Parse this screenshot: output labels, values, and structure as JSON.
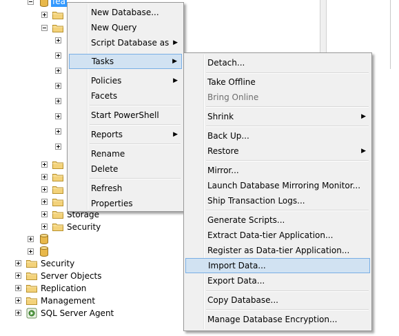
{
  "tree": {
    "selected_db_label": "fea",
    "storage_label": "Storage",
    "security_inner_label": "Security",
    "security_label": "Security",
    "server_objects_label": "Server Objects",
    "replication_label": "Replication",
    "management_label": "Management",
    "agent_label": "SQL Server Agent"
  },
  "context_menu": {
    "new_database": "New Database...",
    "new_query": "New Query",
    "script_database_as": "Script Database as",
    "tasks": "Tasks",
    "policies": "Policies",
    "facets": "Facets",
    "start_powershell": "Start PowerShell",
    "reports": "Reports",
    "rename": "Rename",
    "delete": "Delete",
    "refresh": "Refresh",
    "properties": "Properties"
  },
  "tasks_menu": {
    "detach": "Detach...",
    "take_offline": "Take Offline",
    "bring_online": "Bring Online",
    "shrink": "Shrink",
    "back_up": "Back Up...",
    "restore": "Restore",
    "mirror": "Mirror...",
    "launch_mirroring_monitor": "Launch Database Mirroring Monitor...",
    "ship_transaction_logs": "Ship Transaction Logs...",
    "generate_scripts": "Generate Scripts...",
    "extract_data_tier": "Extract Data-tier Application...",
    "register_data_tier": "Register as Data-tier Application...",
    "import_data": "Import Data...",
    "export_data": "Export Data...",
    "copy_database": "Copy Database...",
    "manage_encryption": "Manage Database Encryption..."
  },
  "colors": {
    "highlight_bg": "#d1e2f2",
    "highlight_border": "#78aee5",
    "selection_blue": "#3399ff",
    "menu_bg": "#f0f0f0",
    "folder_yellow": "#f3d27a",
    "db_gold": "#e8b84a"
  },
  "icons": {
    "folder": "folder-icon",
    "database": "database-icon",
    "agent": "sql-agent-icon",
    "submenu": "chevron-right-icon"
  }
}
